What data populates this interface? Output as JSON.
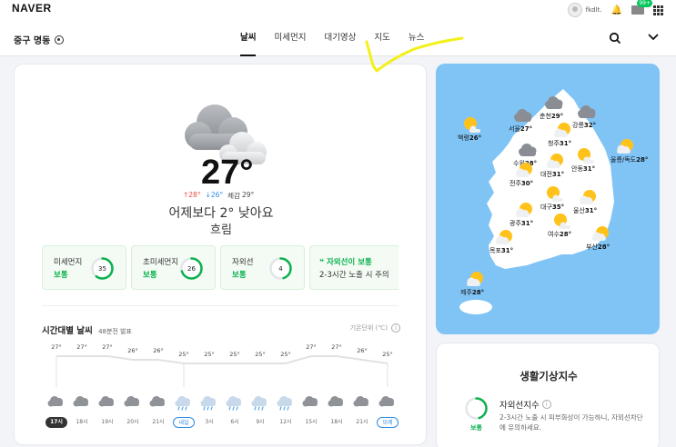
{
  "topbar": {
    "logo": "NAVER",
    "user_id": "fkdlt.",
    "mail_badge": "99+"
  },
  "nav": {
    "location": "중구 명동",
    "tabs": [
      "날씨",
      "미세먼지",
      "대기영상",
      "지도",
      "뉴스"
    ],
    "active_tab": "날씨"
  },
  "current": {
    "temp": "27°",
    "high": "↑28°",
    "low": "↓26°",
    "feels_label": "체감",
    "feels": "29°",
    "compare": "어제보다 2° 낮아요",
    "condition": "흐림"
  },
  "air": [
    {
      "name": "미세먼지",
      "status": "보통",
      "value": "35",
      "fraction": 0.6
    },
    {
      "name": "초미세먼지",
      "status": "보통",
      "value": "26",
      "fraction": 0.7
    },
    {
      "name": "자외선",
      "status": "보통",
      "value": "4",
      "fraction": 0.45
    }
  ],
  "uv_note": {
    "title": "❝ 자외선이 보통",
    "desc": "2-3시간 노출 시 주의"
  },
  "hourly": {
    "title": "시간대별 날씨",
    "announced": "48분전 발표",
    "unit": "기온단위 (℃)",
    "info": "i",
    "temps": [
      "27°",
      "27°",
      "27°",
      "26°",
      "26°",
      "25°",
      "25°",
      "25°",
      "25°",
      "25°",
      "27°",
      "27°",
      "26°",
      "25°"
    ],
    "temp_values": [
      27,
      27,
      27,
      26,
      26,
      25,
      25,
      25,
      25,
      25,
      27,
      27,
      26,
      25
    ],
    "icons": [
      "cloud",
      "cloud",
      "cloud",
      "cloud",
      "cloud",
      "rain",
      "rain",
      "rain",
      "rain",
      "rain",
      "cloud",
      "cloud",
      "cloud",
      "cloud"
    ],
    "labels": [
      "17시",
      "18시",
      "19시",
      "20시",
      "21시",
      "내일",
      "3시",
      "6시",
      "9시",
      "12시",
      "15시",
      "18시",
      "21시",
      "모레"
    ],
    "label_styles": [
      "now",
      "",
      "",
      "",
      "",
      "day",
      "",
      "",
      "",
      "",
      "",
      "",
      "",
      "day"
    ]
  },
  "map": {
    "cities": [
      {
        "name": "춘천",
        "temp": "29°",
        "icon": "cloud"
      },
      {
        "name": "서울",
        "temp": "27°",
        "icon": "cloud"
      },
      {
        "name": "강릉",
        "temp": "32°",
        "icon": "cloud"
      },
      {
        "name": "백령",
        "temp": "26°",
        "icon": "sun"
      },
      {
        "name": "청주",
        "temp": "31°",
        "icon": "suncloud"
      },
      {
        "name": "수원",
        "temp": "28°",
        "icon": "cloud"
      },
      {
        "name": "울릉/독도",
        "temp": "28°",
        "icon": "suncloud"
      },
      {
        "name": "대전",
        "temp": "31°",
        "icon": "suncloud"
      },
      {
        "name": "안동",
        "temp": "31°",
        "icon": "sun"
      },
      {
        "name": "전주",
        "temp": "30°",
        "icon": "suncloud"
      },
      {
        "name": "대구",
        "temp": "35°",
        "icon": "sun"
      },
      {
        "name": "울산",
        "temp": "31°",
        "icon": "suncloud"
      },
      {
        "name": "광주",
        "temp": "31°",
        "icon": "suncloud"
      },
      {
        "name": "여수",
        "temp": "28°",
        "icon": "sun"
      },
      {
        "name": "부산",
        "temp": "28°",
        "icon": "suncloud"
      },
      {
        "name": "목포",
        "temp": "31°",
        "icon": "suncloud"
      },
      {
        "name": "제주",
        "temp": "28°",
        "icon": "suncloud"
      }
    ]
  },
  "life": {
    "title": "생활기상지수",
    "item_name": "자외선지수",
    "info": "i",
    "item_status": "보통",
    "item_desc": "2-3시간 노출 시 피부화상이 가능하니, 자외선차단에 유의하세요.",
    "fraction": 0.45
  },
  "colors": {
    "accent_green": "#03c75a",
    "status_green": "#0bb24d",
    "map_bg": "#80c4f6",
    "land": "#ffffff",
    "high": "#f0483e",
    "low": "#2e8ae6"
  }
}
